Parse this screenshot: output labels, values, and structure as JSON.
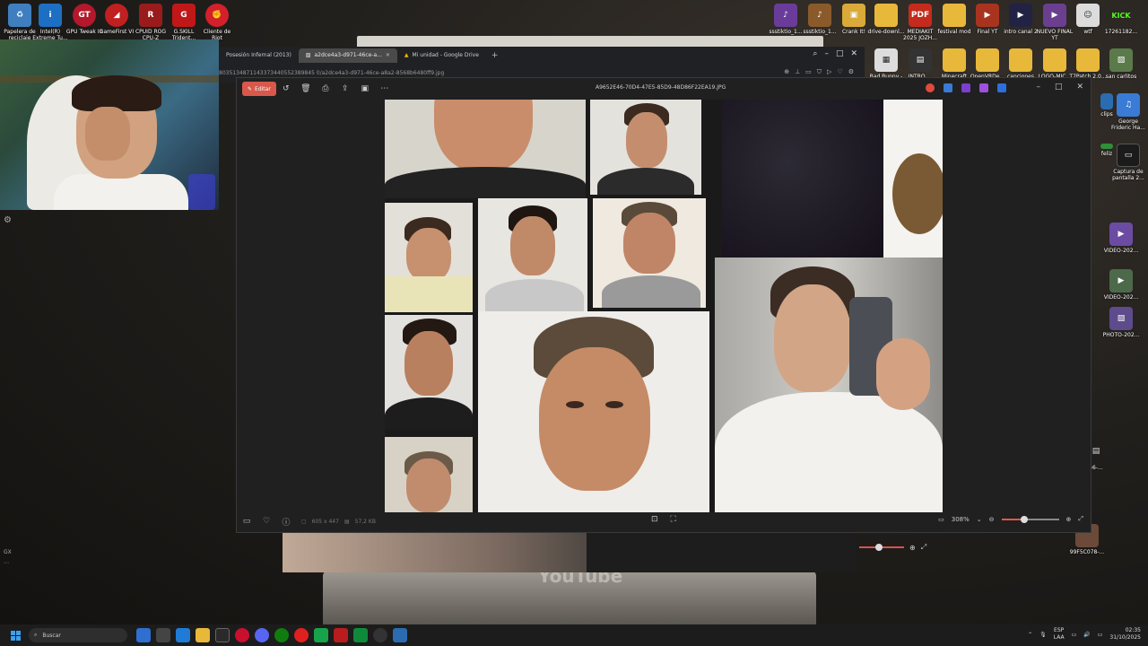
{
  "desktop_icons_left": [
    {
      "label": "Papelera de reciclaje",
      "icon": "recycle-bin-icon"
    },
    {
      "label": "Intel(R) Extreme Tu...",
      "icon": "intel-icon"
    },
    {
      "label": "GPU Tweak III",
      "icon": "gpu-tweak-icon"
    },
    {
      "label": "GameFirst VI",
      "icon": "gamefirst-icon"
    },
    {
      "label": "CPUID ROG CPU-Z",
      "icon": "cpuz-icon"
    },
    {
      "label": "G.SKILL Trident...",
      "icon": "gskill-icon"
    },
    {
      "label": "Cliente de Riot",
      "icon": "riot-icon"
    }
  ],
  "desktop_icons_top_right_row1": [
    {
      "label": "ssstiktio_1...",
      "icon": "file-icon"
    },
    {
      "label": "ssstiktio_1...",
      "icon": "file-icon"
    },
    {
      "label": "Crank It!",
      "icon": "file-icon"
    },
    {
      "label": "drive-downl...",
      "icon": "folder-icon"
    },
    {
      "label": "MEDIAKIT 2025 JOZH...",
      "icon": "pdf-icon"
    },
    {
      "label": "festival mod",
      "icon": "folder-icon"
    },
    {
      "label": "Final YT",
      "icon": "video-icon"
    },
    {
      "label": "intro canal 2",
      "icon": "video-icon"
    },
    {
      "label": "NUEVO FINAL YT",
      "icon": "video-icon"
    },
    {
      "label": "wtf",
      "icon": "image-icon"
    },
    {
      "label": "17261182...",
      "icon": "kick-icon"
    }
  ],
  "desktop_icons_top_right_row2": [
    {
      "label": "Bad Bunny - ...",
      "icon": "file-icon"
    },
    {
      "label": "INTRO ...",
      "icon": "file-icon"
    },
    {
      "label": "Minecraft",
      "icon": "folder-icon"
    },
    {
      "label": "OpenVRDe...",
      "icon": "folder-icon"
    },
    {
      "label": "canciones",
      "icon": "folder-icon"
    },
    {
      "label": "LOGO-MIC...",
      "icon": "folder-icon"
    },
    {
      "label": "T7Patch 2.0...",
      "icon": "folder-icon"
    },
    {
      "label": "san carlitos",
      "icon": "image-icon"
    }
  ],
  "desktop_icons_right_column": [
    {
      "label": "clips",
      "icon": "file-icon"
    },
    {
      "label": "George Frideric Ha...",
      "icon": "file-icon"
    },
    {
      "label": "feliz",
      "icon": "file-icon"
    },
    {
      "label": "Captura de pantalla 2...",
      "icon": "file-icon"
    },
    {
      "label": "VIDEO-202...",
      "icon": "video-icon"
    },
    {
      "label": "VIDEO-202...",
      "icon": "video-icon"
    },
    {
      "label": "PHOTO-202...",
      "icon": "image-icon"
    },
    {
      "label": "46-...",
      "icon": "file-icon"
    },
    {
      "label": "99F5C078-...",
      "icon": "file-icon"
    }
  ],
  "browser": {
    "tabs": [
      {
        "label": "Posesión Infernal (2013)",
        "active": false
      },
      {
        "label": "a2dce4a3-d971-46ce-a...",
        "active": true
      },
      {
        "label": "Mi unidad - Google Drive",
        "active": false
      }
    ],
    "url": "8035134871143373440552389845 0/a2dce4a3-d971-46ce-a8a2-8568b6480ff9.jpg"
  },
  "viewer": {
    "edit_label": "Editar",
    "filename": "A9652E46-70D4-47E5-85D9-48D86F22EA19.JPG",
    "dimensions": "605 x 447",
    "filesize": "57,2 KB",
    "zoom": "308%",
    "zoom_level": 0.4
  },
  "bottom_zoom_slider_level": 0.36,
  "taskbar": {
    "search_placeholder": "Buscar",
    "lang_top": "ESP",
    "lang_bottom": "LAA",
    "time": "02:35",
    "date": "31/10/2025"
  },
  "side_tools": {
    "label": "GX"
  },
  "background": {
    "youtube_text": "YouTube"
  }
}
